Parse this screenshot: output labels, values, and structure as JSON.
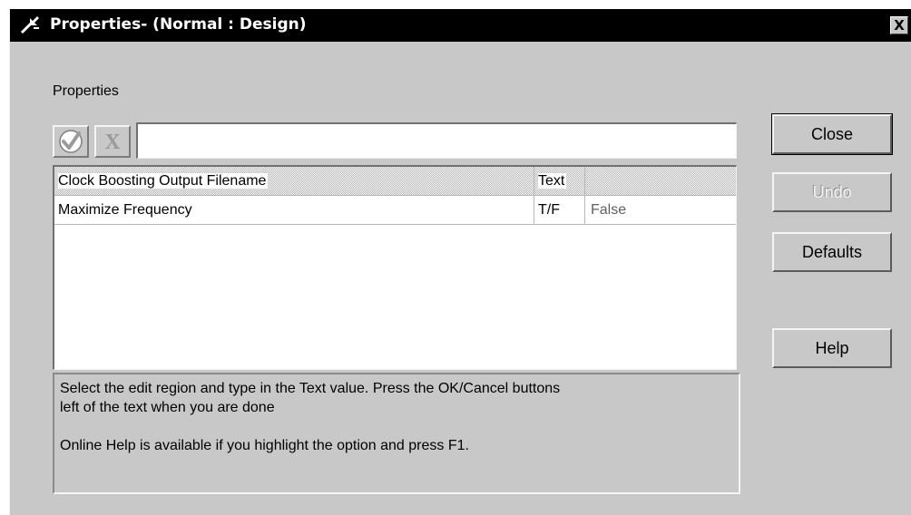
{
  "window": {
    "title": "Properties- (Normal : Design)",
    "close_glyph": "X",
    "icon": "properties-wand-icon"
  },
  "properties_label": "Properties",
  "toolbar": {
    "ok_icon": "checkmark-icon",
    "cancel_icon": "x-cancel-icon",
    "cancel_glyph": "X",
    "edit_value": ""
  },
  "grid": {
    "rows": [
      {
        "name": "Clock Boosting Output Filename",
        "type": "Text",
        "value": "",
        "selected": true
      },
      {
        "name": "Maximize Frequency",
        "type": "T/F",
        "value": "False",
        "selected": false
      }
    ]
  },
  "description": {
    "line1": "Select the edit region and type in the Text value.  Press the OK/Cancel buttons",
    "line2": "left of the text when you are done",
    "line3": "Online Help is available if you highlight the option and press F1."
  },
  "buttons": {
    "close": "Close",
    "undo": "Undo",
    "defaults": "Defaults",
    "help": "Help"
  },
  "colors": {
    "window_bg": "#c8c8c8",
    "titlebar_bg": "#000000",
    "titlebar_text": "#ffffff"
  }
}
